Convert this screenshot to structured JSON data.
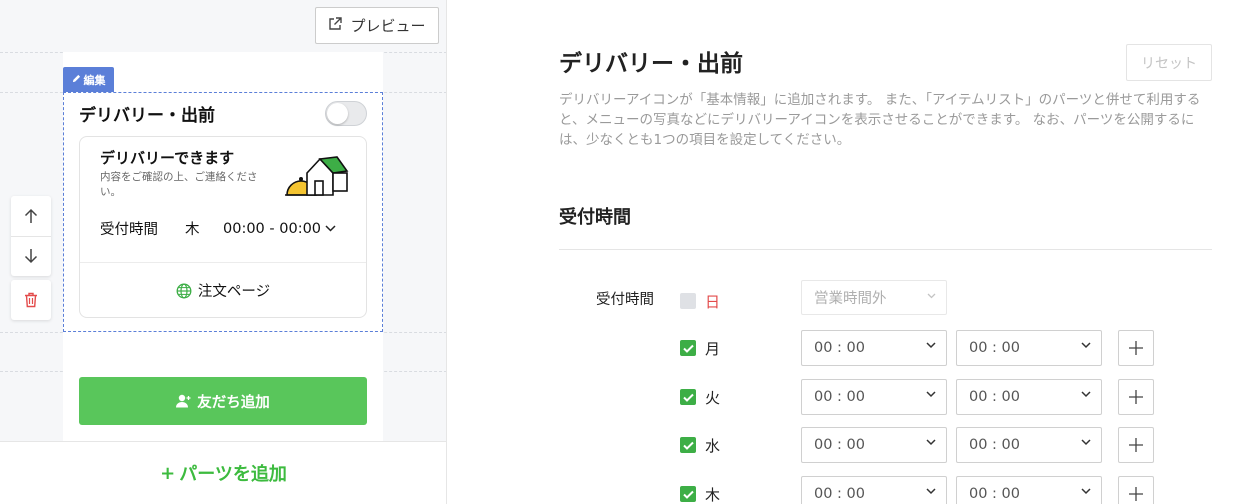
{
  "editor": {
    "preview_label": "プレビュー",
    "edit_badge": "編集",
    "part_title": "デリバリー・出前",
    "card": {
      "title": "デリバリーできます",
      "description": "内容をご確認の上、ご連絡ください。",
      "hours_label": "受付時間",
      "hours_day": "木",
      "hours_value": "00:00 - 00:00",
      "order_link": "注文ページ"
    },
    "add_friend_label": "友だち追加",
    "add_parts_label": "パーツを追加",
    "add_parts_prefix": "+"
  },
  "settings": {
    "title": "デリバリー・出前",
    "reset_label": "リセット",
    "description": "デリバリーアイコンが「基本情報」に追加されます。 また、「アイテムリスト」のパーツと併せて利用すると、メニューの写真などにデリバリーアイコンを表示させることができます。 なお、パーツを公開するには、少なくとも1つの項目を設定してください。",
    "section_title": "受付時間",
    "hours_label": "受付時間",
    "closed_label": "営業時間外",
    "days": [
      {
        "name": "日",
        "checked": false,
        "start": "",
        "end": ""
      },
      {
        "name": "月",
        "checked": true,
        "start": "00 : 00",
        "end": "00 : 00"
      },
      {
        "name": "火",
        "checked": true,
        "start": "00 : 00",
        "end": "00 : 00"
      },
      {
        "name": "水",
        "checked": true,
        "start": "00 : 00",
        "end": "00 : 00"
      },
      {
        "name": "木",
        "checked": true,
        "start": "00 : 00",
        "end": "00 : 00"
      }
    ]
  },
  "colors": {
    "accent_green": "#3dae46",
    "button_green": "#59c65b",
    "edit_blue": "#5b7fd8",
    "sunday_red": "#e34b4b"
  }
}
